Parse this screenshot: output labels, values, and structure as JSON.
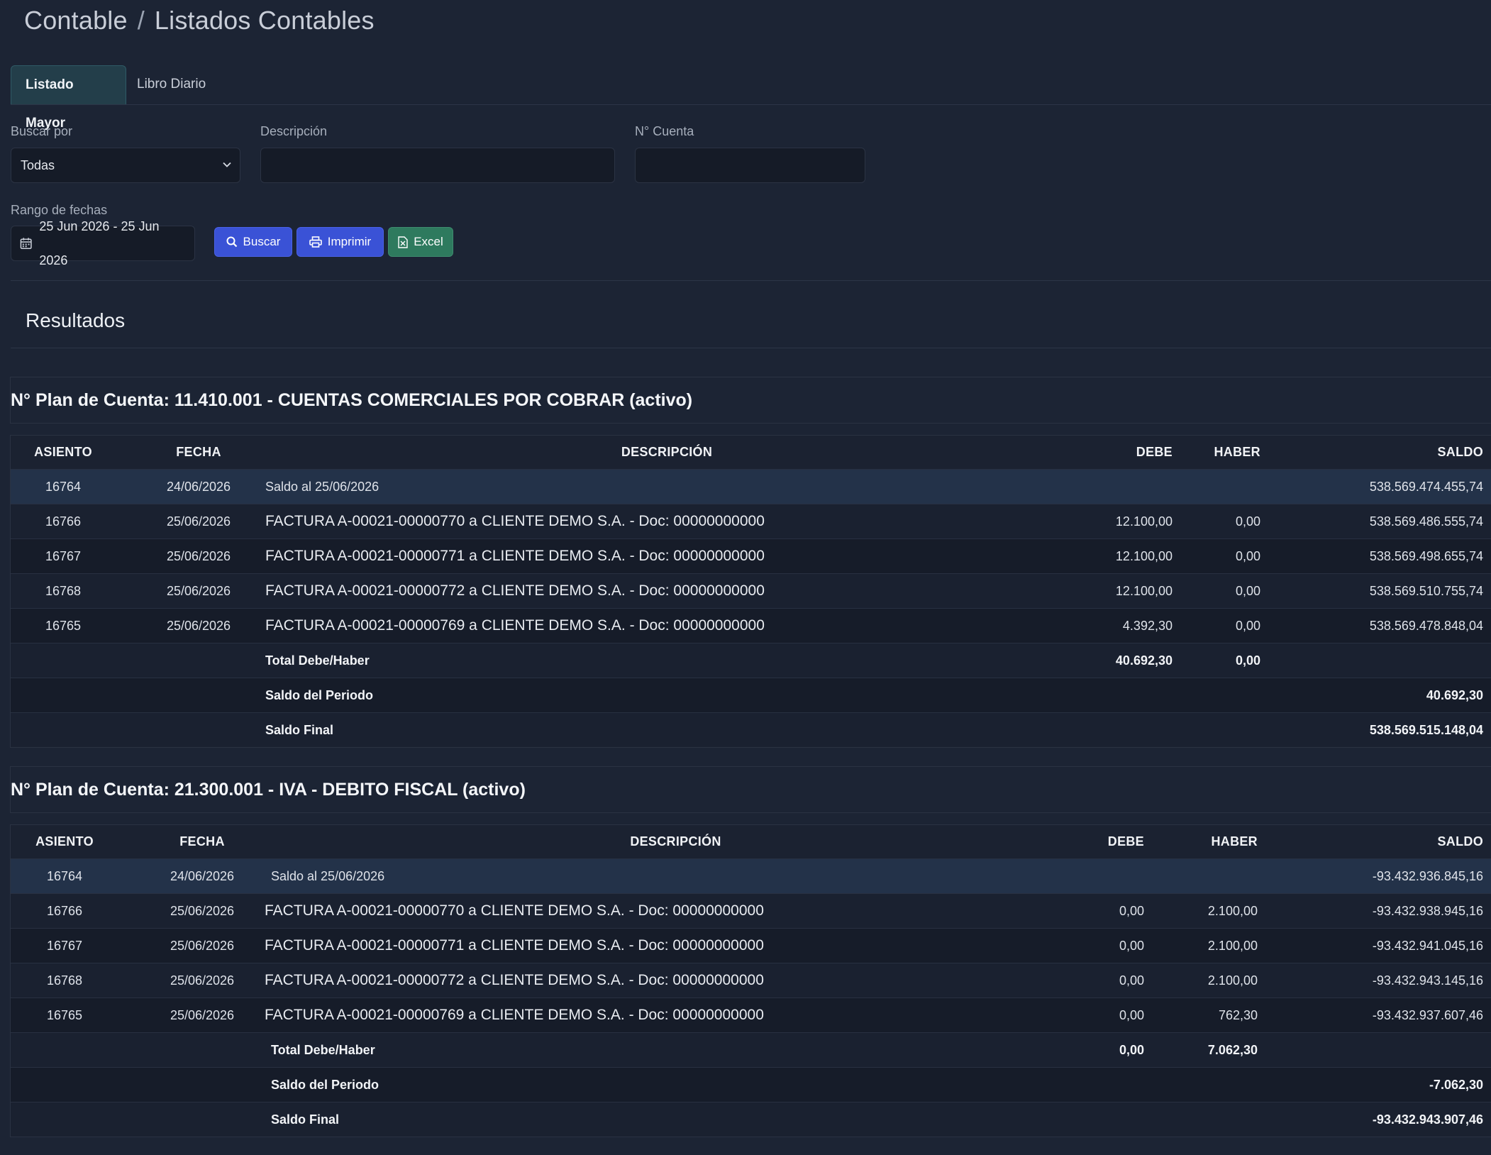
{
  "breadcrumb": {
    "section": "Contable",
    "separator": "/",
    "page": "Listados Contables"
  },
  "tabs": [
    {
      "label": "Listado Mayor",
      "active": true
    },
    {
      "label": "Libro Diario",
      "active": false
    }
  ],
  "filters": {
    "buscar_por": {
      "label": "Buscar por",
      "value": "Todas"
    },
    "descripcion": {
      "label": "Descripción",
      "value": ""
    },
    "cuenta": {
      "label": "N° Cuenta",
      "value": ""
    },
    "rango": {
      "label": "Rango de fechas",
      "value": "25 Jun 2026 - 25 Jun 2026"
    }
  },
  "buttons": {
    "buscar": "Buscar",
    "imprimir": "Imprimir",
    "excel": "Excel"
  },
  "results_title": "Resultados",
  "columns": {
    "asiento": "ASIENTO",
    "fecha": "FECHA",
    "descripcion": "DESCRIPCIÓN",
    "debe": "DEBE",
    "haber": "HABER",
    "saldo": "SALDO"
  },
  "accounts": [
    {
      "title": "N° Plan de Cuenta: 11.410.001 - CUENTAS COMERCIALES POR COBRAR (activo)",
      "rows": [
        {
          "asiento": "16764",
          "fecha": "24/06/2026",
          "descripcion": "Saldo al 25/06/2026",
          "debe": "",
          "haber": "",
          "saldo": "538.569.474.455,74"
        },
        {
          "asiento": "16766",
          "fecha": "25/06/2026",
          "descripcion": "FACTURA A-00021-00000770 a CLIENTE DEMO S.A. - Doc: 00000000000",
          "debe": "12.100,00",
          "haber": "0,00",
          "saldo": "538.569.486.555,74"
        },
        {
          "asiento": "16767",
          "fecha": "25/06/2026",
          "descripcion": "FACTURA A-00021-00000771 a CLIENTE DEMO S.A. - Doc: 00000000000",
          "debe": "12.100,00",
          "haber": "0,00",
          "saldo": "538.569.498.655,74"
        },
        {
          "asiento": "16768",
          "fecha": "25/06/2026",
          "descripcion": "FACTURA A-00021-00000772 a CLIENTE DEMO S.A. - Doc: 00000000000",
          "debe": "12.100,00",
          "haber": "0,00",
          "saldo": "538.569.510.755,74"
        },
        {
          "asiento": "16765",
          "fecha": "25/06/2026",
          "descripcion": "FACTURA A-00021-00000769 a CLIENTE DEMO S.A. - Doc: 00000000000",
          "debe": "4.392,30",
          "haber": "0,00",
          "saldo": "538.569.478.848,04"
        }
      ],
      "totals": [
        {
          "label": "Total Debe/Haber",
          "debe": "40.692,30",
          "haber": "0,00",
          "saldo": ""
        },
        {
          "label": "Saldo del Periodo",
          "debe": "",
          "haber": "",
          "saldo": "40.692,30"
        },
        {
          "label": "Saldo Final",
          "debe": "",
          "haber": "",
          "saldo": "538.569.515.148,04"
        }
      ]
    },
    {
      "title": "N° Plan de Cuenta: 21.300.001 - IVA - DEBITO FISCAL (activo)",
      "rows": [
        {
          "asiento": "16764",
          "fecha": "24/06/2026",
          "descripcion": "Saldo al 25/06/2026",
          "debe": "",
          "haber": "",
          "saldo": "-93.432.936.845,16"
        },
        {
          "asiento": "16766",
          "fecha": "25/06/2026",
          "descripcion": "FACTURA A-00021-00000770 a CLIENTE DEMO S.A. - Doc: 00000000000",
          "debe": "0,00",
          "haber": "2.100,00",
          "saldo": "-93.432.938.945,16"
        },
        {
          "asiento": "16767",
          "fecha": "25/06/2026",
          "descripcion": "FACTURA A-00021-00000771 a CLIENTE DEMO S.A. - Doc: 00000000000",
          "debe": "0,00",
          "haber": "2.100,00",
          "saldo": "-93.432.941.045,16"
        },
        {
          "asiento": "16768",
          "fecha": "25/06/2026",
          "descripcion": "FACTURA A-00021-00000772 a CLIENTE DEMO S.A. - Doc: 00000000000",
          "debe": "0,00",
          "haber": "2.100,00",
          "saldo": "-93.432.943.145,16"
        },
        {
          "asiento": "16765",
          "fecha": "25/06/2026",
          "descripcion": "FACTURA A-00021-00000769 a CLIENTE DEMO S.A. - Doc: 00000000000",
          "debe": "0,00",
          "haber": "762,30",
          "saldo": "-93.432.937.607,46"
        }
      ],
      "totals": [
        {
          "label": "Total Debe/Haber",
          "debe": "0,00",
          "haber": "7.062,30",
          "saldo": ""
        },
        {
          "label": "Saldo del Periodo",
          "debe": "",
          "haber": "",
          "saldo": "-7.062,30"
        },
        {
          "label": "Saldo Final",
          "debe": "",
          "haber": "",
          "saldo": "-93.432.943.907,46"
        }
      ]
    }
  ]
}
